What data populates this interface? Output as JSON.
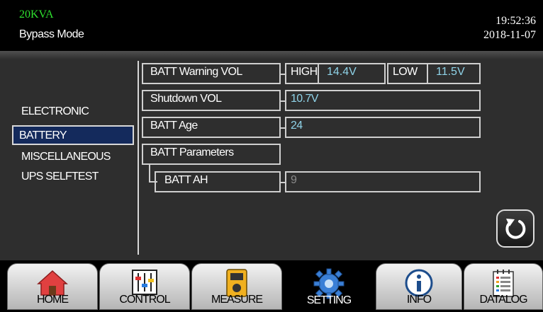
{
  "header": {
    "model": "20KVA",
    "mode": "Bypass Mode",
    "time": "19:52:36",
    "date": "2018-11-07"
  },
  "sidebar": {
    "items": [
      "ELECTRONIC",
      "BATTERY",
      "MISCELLANEOUS",
      "UPS SELFTEST"
    ],
    "selected": "BATTERY"
  },
  "settings": {
    "batt_warning_label": "BATT Warning VOL",
    "high_label": "HIGH",
    "high_value": "14.4V",
    "low_label": "LOW",
    "low_value": "11.5V",
    "shutdown_label": "Shutdown VOL",
    "shutdown_value": "10.7V",
    "batt_age_label": "BATT Age",
    "batt_age_value": "24",
    "batt_params_label": "BATT Parameters",
    "batt_ah_label": "BATT AH",
    "batt_ah_value": "9"
  },
  "nav": {
    "tabs": [
      "HOME",
      "CONTROL",
      "MEASURE",
      "SETTING",
      "INFO",
      "DATALOG"
    ],
    "active": "SETTING"
  },
  "icons": {
    "back": "back-arrow-icon",
    "home": "home-icon",
    "control": "mixer-sliders-icon",
    "measure": "multimeter-icon",
    "setting": "gear-icon",
    "info": "info-icon",
    "datalog": "notebook-icon"
  },
  "colors": {
    "accent_green": "#2ee02e",
    "value_blue": "#8fd3e8",
    "selected_bg": "#142a5c"
  }
}
